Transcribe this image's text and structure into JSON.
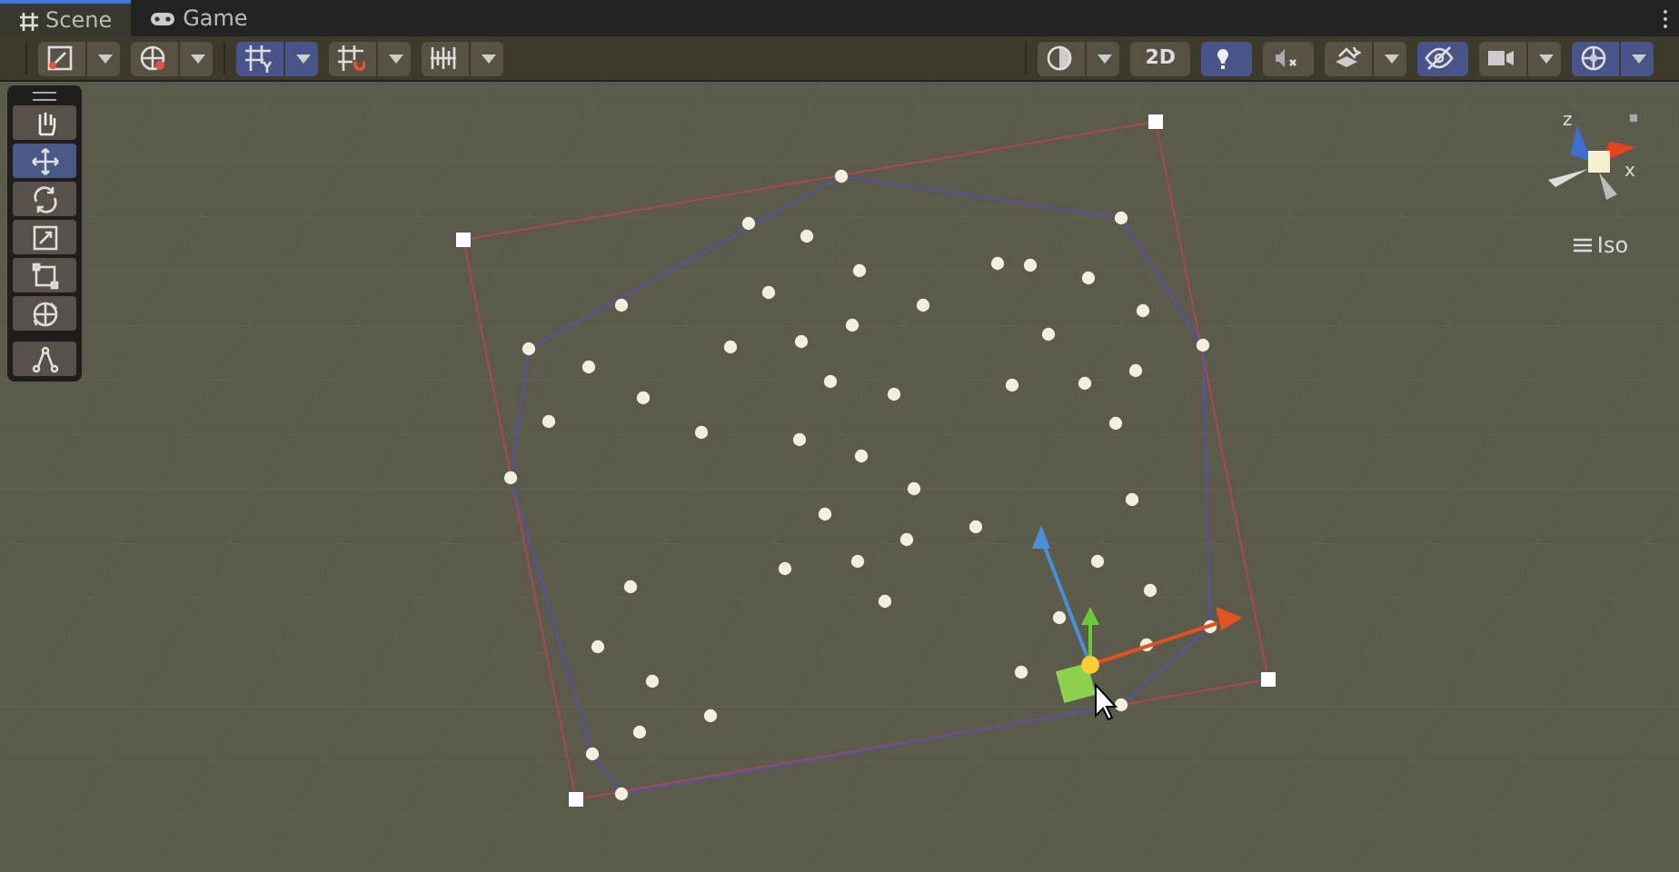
{
  "tabs": [
    {
      "label": "Scene",
      "selected": true
    },
    {
      "label": "Game",
      "selected": false
    }
  ],
  "toolbar_left": [
    {
      "on": false,
      "dropdown": true
    },
    {
      "on": false,
      "dropdown": true
    },
    {
      "on": true,
      "dropdown": true
    },
    {
      "on": false,
      "dropdown": true
    },
    {
      "on": false,
      "dropdown": true
    }
  ],
  "toolbar_right": [
    {
      "on": false,
      "dropdown": true
    },
    {
      "label": "2D",
      "on": false,
      "dropdown": false
    },
    {
      "on": true,
      "dropdown": false
    },
    {
      "on": false,
      "dropdown": false
    },
    {
      "on": false,
      "dropdown": true
    },
    {
      "on": true,
      "dropdown": false
    },
    {
      "on": false,
      "dropdown": true
    },
    {
      "on": true,
      "dropdown": true
    }
  ],
  "tools": [
    {
      "selected": false
    },
    {
      "selected": true
    },
    {
      "selected": false
    },
    {
      "selected": false
    },
    {
      "selected": false
    },
    {
      "selected": false
    },
    {
      "selected": false
    }
  ],
  "orientation_gizmo": {
    "axis_labels": [
      "z",
      "x"
    ],
    "projection": "Iso"
  }
}
